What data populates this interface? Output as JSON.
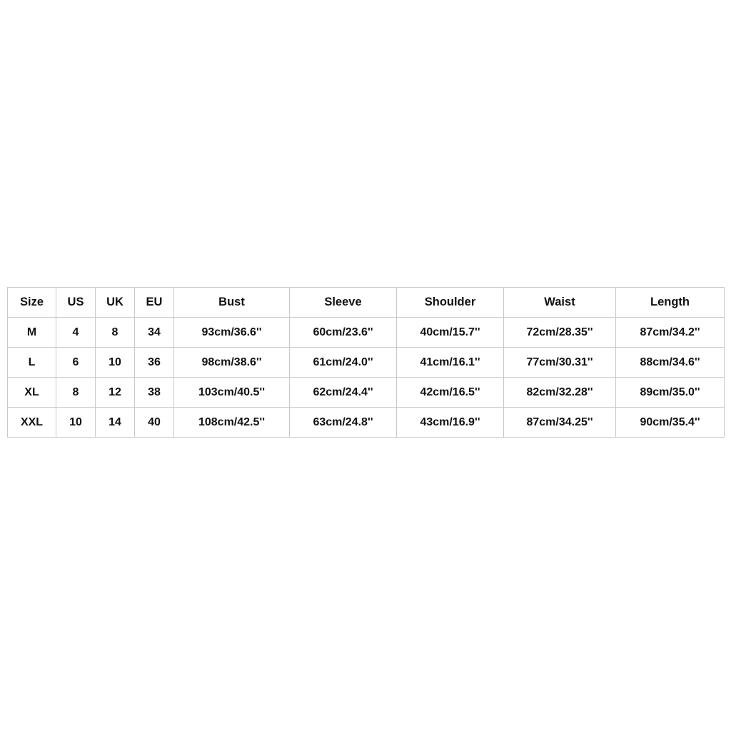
{
  "chart_data": {
    "type": "table",
    "title": "",
    "columns": [
      "Size",
      "US",
      "UK",
      "EU",
      "Bust",
      "Sleeve",
      "Shoulder",
      "Waist",
      "Length"
    ],
    "rows": [
      [
        "M",
        "4",
        "8",
        "34",
        "93cm/36.6''",
        "60cm/23.6''",
        "40cm/15.7''",
        "72cm/28.35''",
        "87cm/34.2''"
      ],
      [
        "L",
        "6",
        "10",
        "36",
        "98cm/38.6''",
        "61cm/24.0''",
        "41cm/16.1''",
        "77cm/30.31''",
        "88cm/34.6''"
      ],
      [
        "XL",
        "8",
        "12",
        "38",
        "103cm/40.5''",
        "62cm/24.4''",
        "42cm/16.5''",
        "82cm/32.28''",
        "89cm/35.0''"
      ],
      [
        "XXL",
        "10",
        "14",
        "40",
        "108cm/42.5''",
        "63cm/24.8''",
        "43cm/16.9''",
        "87cm/34.25''",
        "90cm/35.4''"
      ]
    ]
  },
  "table": {
    "headers": {
      "size": "Size",
      "us": "US",
      "uk": "UK",
      "eu": "EU",
      "bust": "Bust",
      "sleeve": "Sleeve",
      "shoulder": "Shoulder",
      "waist": "Waist",
      "length": "Length"
    },
    "rows": [
      {
        "size": "M",
        "us": "4",
        "uk": "8",
        "eu": "34",
        "bust": "93cm/36.6''",
        "sleeve": "60cm/23.6''",
        "shoulder": "40cm/15.7''",
        "waist": "72cm/28.35''",
        "length": "87cm/34.2''"
      },
      {
        "size": "L",
        "us": "6",
        "uk": "10",
        "eu": "36",
        "bust": "98cm/38.6''",
        "sleeve": "61cm/24.0''",
        "shoulder": "41cm/16.1''",
        "waist": "77cm/30.31''",
        "length": "88cm/34.6''"
      },
      {
        "size": "XL",
        "us": "8",
        "uk": "12",
        "eu": "38",
        "bust": "103cm/40.5''",
        "sleeve": "62cm/24.4''",
        "shoulder": "42cm/16.5''",
        "waist": "82cm/32.28''",
        "length": "89cm/35.0''"
      },
      {
        "size": "XXL",
        "us": "10",
        "uk": "14",
        "eu": "40",
        "bust": "108cm/42.5''",
        "sleeve": "63cm/24.8''",
        "shoulder": "43cm/16.9''",
        "waist": "87cm/34.25''",
        "length": "90cm/35.4''"
      }
    ]
  },
  "colors": {
    "background": "#ffffff",
    "border": "#c9c9c9",
    "text": "#111111"
  }
}
